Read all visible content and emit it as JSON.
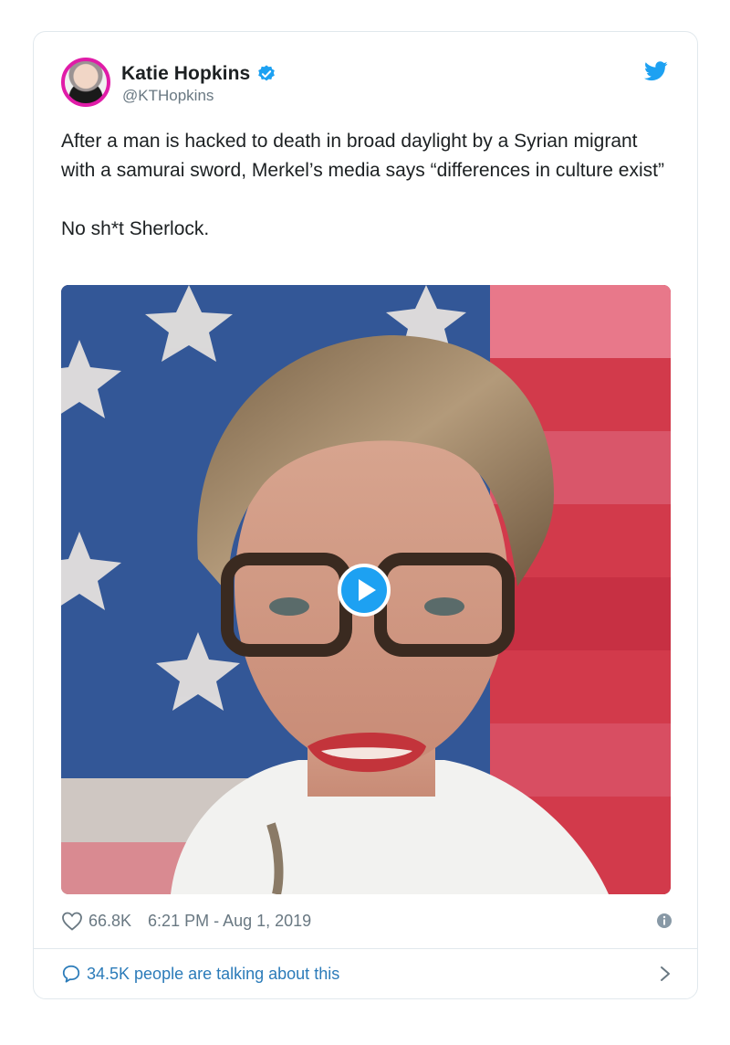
{
  "author": {
    "name": "Katie Hopkins",
    "handle": "@KTHopkins",
    "verified": true
  },
  "tweet": {
    "paragraphs": [
      "After a man is hacked to death in broad daylight by a Syrian migrant with a samurai sword, Merkel’s media says “differences in culture exist”",
      "No sh*t Sherlock."
    ]
  },
  "media": {
    "type": "video",
    "play_icon": "play-icon"
  },
  "meta": {
    "likes": "66.8K",
    "timestamp": "6:21 PM - Aug 1, 2019"
  },
  "footer": {
    "talking": "34.5K people are talking about this"
  },
  "colors": {
    "twitter_blue": "#1da1f2",
    "link_blue": "#2b7bb9",
    "meta_gray": "#697882",
    "text_dark": "#1c2022",
    "avatar_ring": "#e01ca8"
  },
  "icons": [
    "verified-icon",
    "twitter-bird-icon",
    "heart-icon",
    "info-icon",
    "reply-bubble-icon",
    "chevron-right-icon",
    "play-icon"
  ]
}
